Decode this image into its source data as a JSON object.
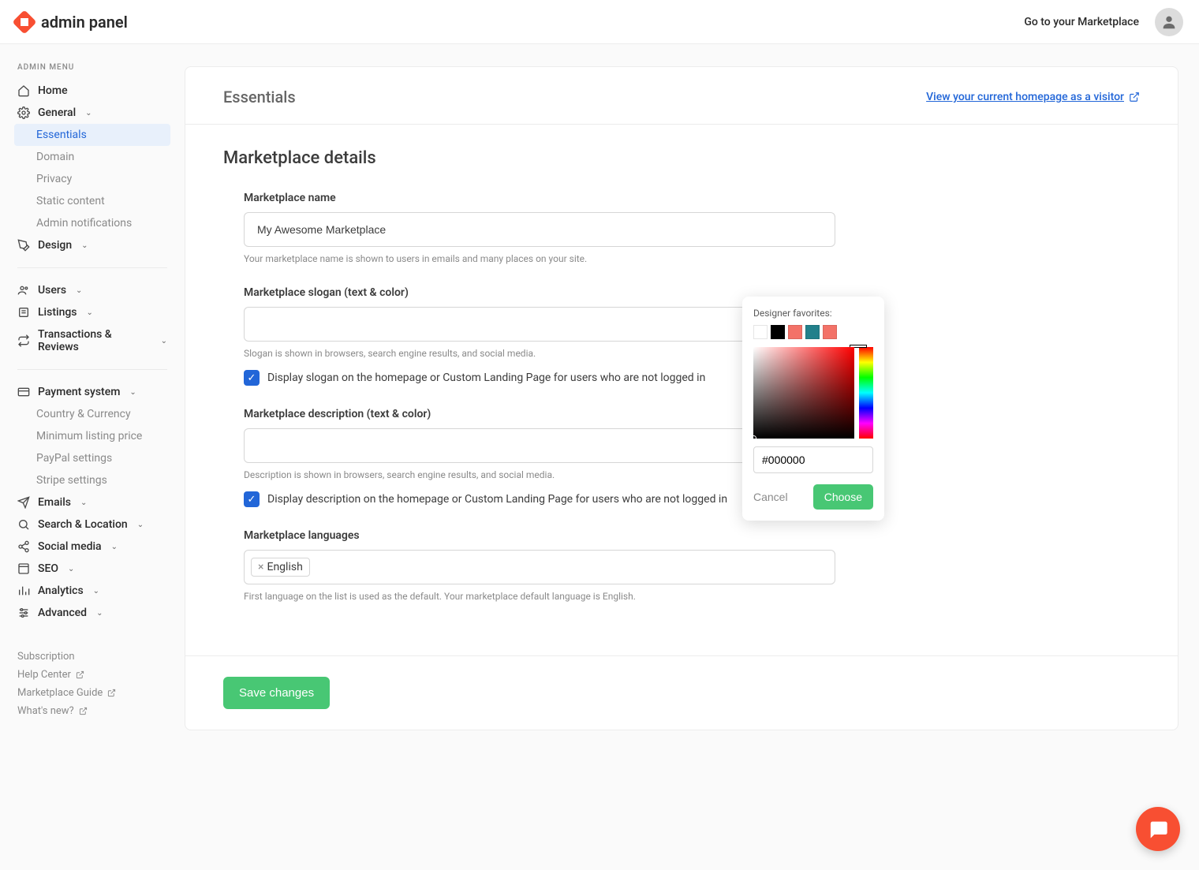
{
  "brand": {
    "title": "admin panel"
  },
  "topbar": {
    "link": "Go to your Marketplace"
  },
  "sidebar": {
    "section_title": "ADMIN MENU",
    "home": "Home",
    "general": "General",
    "general_children": {
      "essentials": "Essentials",
      "domain": "Domain",
      "privacy": "Privacy",
      "static_content": "Static content",
      "admin_notifications": "Admin notifications"
    },
    "design": "Design",
    "users": "Users",
    "listings": "Listings",
    "transactions": "Transactions & Reviews",
    "payment": "Payment system",
    "payment_children": {
      "country": "Country & Currency",
      "min_price": "Minimum listing price",
      "paypal": "PayPal settings",
      "stripe": "Stripe settings"
    },
    "emails": "Emails",
    "search": "Search & Location",
    "social": "Social media",
    "seo": "SEO",
    "analytics": "Analytics",
    "advanced": "Advanced",
    "footer": {
      "subscription": "Subscription",
      "help": "Help Center",
      "guide": "Marketplace Guide",
      "whatsnew": "What's new?"
    }
  },
  "main": {
    "page_title": "Essentials",
    "view_link": "View your current homepage as a visitor",
    "section_title": "Marketplace details",
    "name": {
      "label": "Marketplace name",
      "value": "My Awesome Marketplace",
      "help": "Your marketplace name is shown to users in emails and many places on your site."
    },
    "slogan": {
      "label": "Marketplace slogan (text & color)",
      "value": "",
      "help": "Slogan is shown in browsers, search engine results, and social media.",
      "checkbox": "Display slogan on the homepage or Custom Landing Page for users who are not logged in"
    },
    "description": {
      "label": "Marketplace description (text & color)",
      "value": "",
      "help": "Description is shown in browsers, search engine results, and social media.",
      "checkbox": "Display description on the homepage or Custom Landing Page for users who are not logged in"
    },
    "languages": {
      "label": "Marketplace languages",
      "chip": "English",
      "help": "First language on the list is used as the default. Your marketplace default language is English."
    },
    "save": "Save changes"
  },
  "picker": {
    "title": "Designer favorites:",
    "favorites": [
      "#ffffff",
      "#000000",
      "#f37268",
      "#22808b",
      "#f37268"
    ],
    "hex": "#000000",
    "cancel": "Cancel",
    "choose": "Choose"
  }
}
